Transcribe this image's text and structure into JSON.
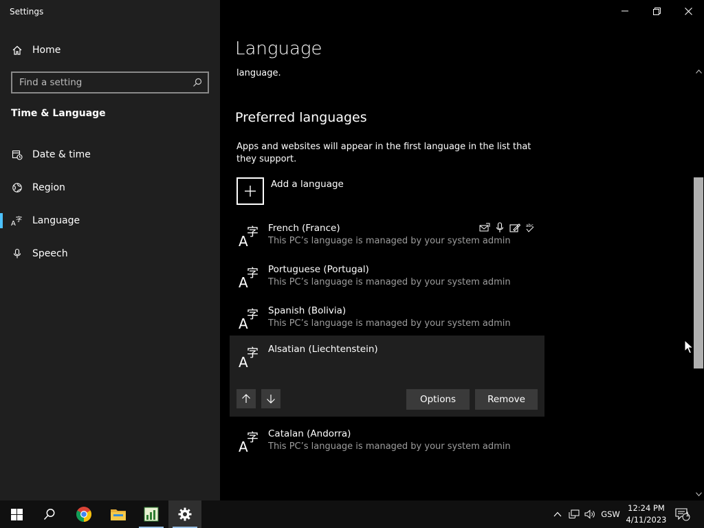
{
  "window": {
    "title": "Settings"
  },
  "sidebar": {
    "home": "Home",
    "search_placeholder": "Find a setting",
    "section": "Time & Language",
    "items": [
      {
        "label": "Date & time",
        "icon": "calendar-clock-icon"
      },
      {
        "label": "Region",
        "icon": "globe-icon"
      },
      {
        "label": "Language",
        "icon": "language-icon",
        "active": true
      },
      {
        "label": "Speech",
        "icon": "microphone-icon"
      }
    ]
  },
  "main": {
    "title": "Language",
    "clipped_text": "language.",
    "preferred_heading": "Preferred languages",
    "preferred_desc": "Apps and websites will appear in the first language in the list that they support.",
    "add_language": "Add a language",
    "languages": [
      {
        "name": "French (France)",
        "sub": "This PC’s language is managed by your system admin"
      },
      {
        "name": "Portuguese (Portugal)",
        "sub": "This PC’s language is managed by your system admin"
      },
      {
        "name": "Spanish (Bolivia)",
        "sub": "This PC’s language is managed by your system admin"
      },
      {
        "name": "Alsatian (Liechtenstein)",
        "sub": ""
      },
      {
        "name": "Catalan (Andorra)",
        "sub": "This PC’s language is managed by your system admin"
      }
    ],
    "options_label": "Options",
    "remove_label": "Remove"
  },
  "taskbar": {
    "ime": "GSW",
    "time": "12:24 PM",
    "date": "4/11/2023",
    "notification_count": "1"
  },
  "colors": {
    "accent": "#4cc2ff",
    "sidebar_bg": "#1f1f1f",
    "content_bg": "#000000",
    "subtext": "#9d9d9d"
  }
}
